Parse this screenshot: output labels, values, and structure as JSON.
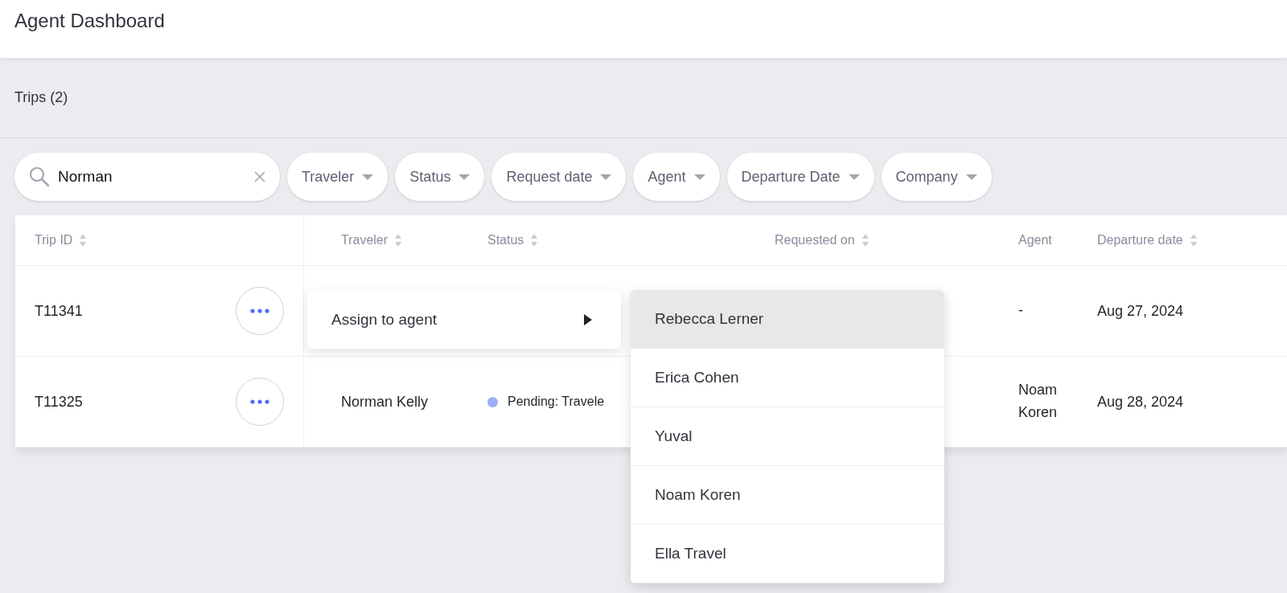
{
  "header": {
    "title": "Agent Dashboard"
  },
  "section": {
    "title": "Trips (2)"
  },
  "search": {
    "value": "Norman"
  },
  "filters": [
    {
      "label": "Traveler"
    },
    {
      "label": "Status"
    },
    {
      "label": "Request date"
    },
    {
      "label": "Agent"
    },
    {
      "label": "Departure Date"
    },
    {
      "label": "Company"
    }
  ],
  "table": {
    "columns": [
      {
        "label": "Trip ID",
        "sortable": true
      },
      {
        "label": "Traveler",
        "sortable": true
      },
      {
        "label": "Status",
        "sortable": true
      },
      {
        "label": "Requested on",
        "sortable": true
      },
      {
        "label": "Agent",
        "sortable": false
      },
      {
        "label": "Departure date",
        "sortable": true
      }
    ],
    "rows": [
      {
        "trip_id": "T11341",
        "agent": "-",
        "departure": "Aug 27, 2024"
      },
      {
        "trip_id": "T11325",
        "traveler": "Norman Kelly",
        "status": {
          "text": "Pending: Travele",
          "color": "#9bb0f5"
        },
        "agent": "Noam Koren",
        "departure": "Aug 28, 2024"
      }
    ]
  },
  "context_menu": {
    "items": [
      {
        "label": "Assign to agent"
      }
    ]
  },
  "agent_menu": {
    "items": [
      {
        "label": "Rebecca Lerner",
        "selected": true
      },
      {
        "label": "Erica Cohen",
        "selected": false
      },
      {
        "label": "Yuval",
        "selected": false
      },
      {
        "label": "Noam Koren",
        "selected": false
      },
      {
        "label": "Ella Travel",
        "selected": false
      }
    ]
  }
}
